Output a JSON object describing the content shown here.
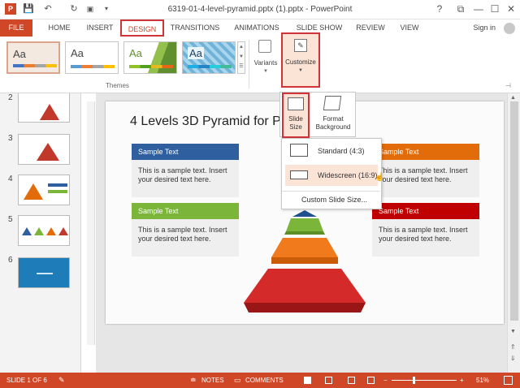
{
  "window": {
    "title": "6319-01-4-level-pyramid.pptx (1).pptx - PowerPoint",
    "help": "?",
    "min": "—",
    "max": "☐",
    "close": "✕",
    "restore": "⧉"
  },
  "quick_access": {
    "save": "💾",
    "undo": "↶",
    "redo": "↻"
  },
  "tabs": [
    "FILE",
    "HOME",
    "INSERT",
    "DESIGN",
    "TRANSITIONS",
    "ANIMATIONS",
    "SLIDE SHOW",
    "REVIEW",
    "VIEW"
  ],
  "signin": "Sign in",
  "ribbon": {
    "themes_label": "Themes",
    "theme_tiles": [
      "Aa",
      "Aa",
      "Aa",
      "Aa"
    ],
    "variants_label": "Variants",
    "customize_label": "Customize",
    "slide_size_label": "Slide Size",
    "format_background_label": "Format Background"
  },
  "slide_size_menu": {
    "options": [
      "Standard (4:3)",
      "Widescreen (16:9)"
    ],
    "custom": "Custom Slide Size..."
  },
  "thumbnails": [
    "2",
    "3",
    "4",
    "5",
    "6"
  ],
  "slide": {
    "title": "4 Levels 3D Pyramid for P",
    "cards": [
      {
        "header": "Sample Text",
        "body": "This is a sample text. Insert your desired text here."
      },
      {
        "header": "Sample Text",
        "body": "This is a sample text. Insert your desired text here."
      },
      {
        "header": "Sample Text",
        "body": "This is a sample text. Insert your desired text here."
      },
      {
        "header": "Sample Text",
        "body": "This is a sample text. Insert your desired text here."
      }
    ]
  },
  "status": {
    "slide_info": "SLIDE 1 OF 6",
    "notes": "NOTES",
    "comments": "COMMENTS",
    "zoom": "51%",
    "minus": "−",
    "plus": "+"
  },
  "colors": {
    "accent": "#d04727",
    "highlight": "#d13438",
    "blue": "#2f5f9e",
    "orange": "#e36c0a",
    "green": "#7bb63a",
    "red": "#c00000"
  }
}
